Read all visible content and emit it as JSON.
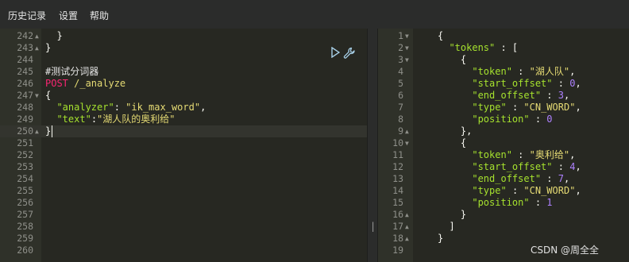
{
  "menu": {
    "history": "历史记录",
    "settings": "设置",
    "help": "帮助"
  },
  "request_editor": {
    "lines": [
      {
        "num": "242",
        "fold": "▲",
        "text": "  }"
      },
      {
        "num": "243",
        "fold": "▲",
        "text": "}"
      },
      {
        "num": "244",
        "fold": "",
        "text": ""
      },
      {
        "num": "245",
        "fold": "",
        "text": "#测试分词器"
      },
      {
        "num": "246",
        "fold": "",
        "method": "POST",
        "path": " /_analyze"
      },
      {
        "num": "247",
        "fold": "▼",
        "text": "{"
      },
      {
        "num": "248",
        "fold": "",
        "key": "\"analyzer\"",
        "sep": ": ",
        "value": "\"ik_max_word\"",
        "tail": ","
      },
      {
        "num": "249",
        "fold": "",
        "key": "\"text\"",
        "sep": ":",
        "value": "\"湖人队的奥利给\"",
        "tail": ""
      },
      {
        "num": "250",
        "fold": "▲",
        "text": "}"
      },
      {
        "num": "251",
        "fold": "",
        "text": ""
      },
      {
        "num": "252",
        "fold": "",
        "text": ""
      },
      {
        "num": "253",
        "fold": "",
        "text": ""
      },
      {
        "num": "254",
        "fold": "",
        "text": ""
      },
      {
        "num": "255",
        "fold": "",
        "text": ""
      },
      {
        "num": "256",
        "fold": "",
        "text": ""
      },
      {
        "num": "257",
        "fold": "",
        "text": ""
      },
      {
        "num": "258",
        "fold": "",
        "text": ""
      },
      {
        "num": "259",
        "fold": "",
        "text": ""
      },
      {
        "num": "260",
        "fold": "",
        "text": ""
      }
    ],
    "run_icon": "play-icon",
    "settings_icon": "wrench-icon"
  },
  "response_viewer": {
    "lines": [
      {
        "num": "1",
        "fold": "▼",
        "parts": [
          [
            "punc",
            "{"
          ]
        ]
      },
      {
        "num": "2",
        "fold": "▼",
        "parts": [
          [
            "punc",
            "  "
          ],
          [
            "key",
            "\"tokens\""
          ],
          [
            "punc",
            " : ["
          ]
        ]
      },
      {
        "num": "3",
        "fold": "▼",
        "parts": [
          [
            "punc",
            "    {"
          ]
        ]
      },
      {
        "num": "4",
        "fold": "",
        "parts": [
          [
            "punc",
            "      "
          ],
          [
            "key",
            "\"token\""
          ],
          [
            "punc",
            " : "
          ],
          [
            "str",
            "\"湖人队\""
          ],
          [
            "punc",
            ","
          ]
        ]
      },
      {
        "num": "5",
        "fold": "",
        "parts": [
          [
            "punc",
            "      "
          ],
          [
            "key",
            "\"start_offset\""
          ],
          [
            "punc",
            " : "
          ],
          [
            "num",
            "0"
          ],
          [
            "punc",
            ","
          ]
        ]
      },
      {
        "num": "6",
        "fold": "",
        "parts": [
          [
            "punc",
            "      "
          ],
          [
            "key",
            "\"end_offset\""
          ],
          [
            "punc",
            " : "
          ],
          [
            "num",
            "3"
          ],
          [
            "punc",
            ","
          ]
        ]
      },
      {
        "num": "7",
        "fold": "",
        "parts": [
          [
            "punc",
            "      "
          ],
          [
            "key",
            "\"type\""
          ],
          [
            "punc",
            " : "
          ],
          [
            "str",
            "\"CN_WORD\""
          ],
          [
            "punc",
            ","
          ]
        ]
      },
      {
        "num": "8",
        "fold": "",
        "parts": [
          [
            "punc",
            "      "
          ],
          [
            "key",
            "\"position\""
          ],
          [
            "punc",
            " : "
          ],
          [
            "num",
            "0"
          ]
        ]
      },
      {
        "num": "9",
        "fold": "▲",
        "parts": [
          [
            "punc",
            "    },"
          ]
        ]
      },
      {
        "num": "10",
        "fold": "▼",
        "parts": [
          [
            "punc",
            "    {"
          ]
        ]
      },
      {
        "num": "11",
        "fold": "",
        "parts": [
          [
            "punc",
            "      "
          ],
          [
            "key",
            "\"token\""
          ],
          [
            "punc",
            " : "
          ],
          [
            "str",
            "\"奥利给\""
          ],
          [
            "punc",
            ","
          ]
        ]
      },
      {
        "num": "12",
        "fold": "",
        "parts": [
          [
            "punc",
            "      "
          ],
          [
            "key",
            "\"start_offset\""
          ],
          [
            "punc",
            " : "
          ],
          [
            "num",
            "4"
          ],
          [
            "punc",
            ","
          ]
        ]
      },
      {
        "num": "13",
        "fold": "",
        "parts": [
          [
            "punc",
            "      "
          ],
          [
            "key",
            "\"end_offset\""
          ],
          [
            "punc",
            " : "
          ],
          [
            "num",
            "7"
          ],
          [
            "punc",
            ","
          ]
        ]
      },
      {
        "num": "14",
        "fold": "",
        "parts": [
          [
            "punc",
            "      "
          ],
          [
            "key",
            "\"type\""
          ],
          [
            "punc",
            " : "
          ],
          [
            "str",
            "\"CN_WORD\""
          ],
          [
            "punc",
            ","
          ]
        ]
      },
      {
        "num": "15",
        "fold": "",
        "parts": [
          [
            "punc",
            "      "
          ],
          [
            "key",
            "\"position\""
          ],
          [
            "punc",
            " : "
          ],
          [
            "num",
            "1"
          ]
        ]
      },
      {
        "num": "16",
        "fold": "▲",
        "parts": [
          [
            "punc",
            "    }"
          ]
        ]
      },
      {
        "num": "17",
        "fold": "▲",
        "parts": [
          [
            "punc",
            "  ]"
          ]
        ]
      },
      {
        "num": "18",
        "fold": "▲",
        "parts": [
          [
            "punc",
            "}"
          ]
        ]
      },
      {
        "num": "19",
        "fold": "",
        "parts": []
      }
    ]
  },
  "divider_handle": "||",
  "watermark": "CSDN @周全全",
  "colors": {
    "background": "#272822",
    "gutter": "#2f3129",
    "method": "#f92672",
    "key": "#a6e22e",
    "string": "#e6db74",
    "number": "#ae81ff"
  }
}
